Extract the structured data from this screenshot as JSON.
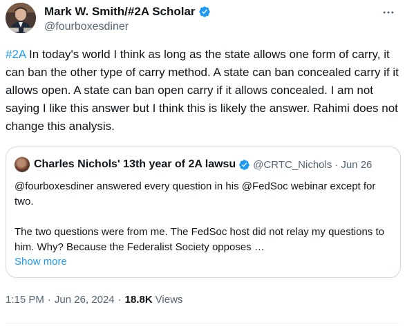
{
  "author": {
    "display_name": "Mark W. Smith/#2A Scholar",
    "handle": "@fourboxesdiner",
    "verified": true
  },
  "tweet": {
    "hashtag": "#2A",
    "text": " In today's world I think as long as the state allows one form of carry, it can ban the other type of carry method. A state can ban concealed carry if it allows open. A state can ban open carry if it allows concealed.  I am not saying I like this answer but I think this is likely the answer. Rahimi does not change this analysis."
  },
  "quoted_tweet": {
    "display_name": "Charles Nichols' 13th year of 2A lawsu",
    "handle": "@CRTC_Nichols",
    "separator": "·",
    "date": "Jun 26",
    "paragraph_1": "@fourboxesdiner answered every question in his @FedSoc webinar except for two.",
    "paragraph_2": "The two questions were from me.  The FedSoc host did not relay my questions to him.  Why?  Because the Federalist Society opposes …",
    "show_more_label": "Show more"
  },
  "meta": {
    "time": "1:15 PM",
    "separator": "·",
    "date": "Jun 26, 2024",
    "views_count": "18.8K",
    "views_label": "Views"
  },
  "icons": {
    "more": "more-horizontal-icon",
    "verified": "verified-badge-icon"
  },
  "colors": {
    "accent": "#1d9bf0",
    "text": "#0f1419",
    "secondary_text": "#536471",
    "border": "#cfd9de"
  }
}
